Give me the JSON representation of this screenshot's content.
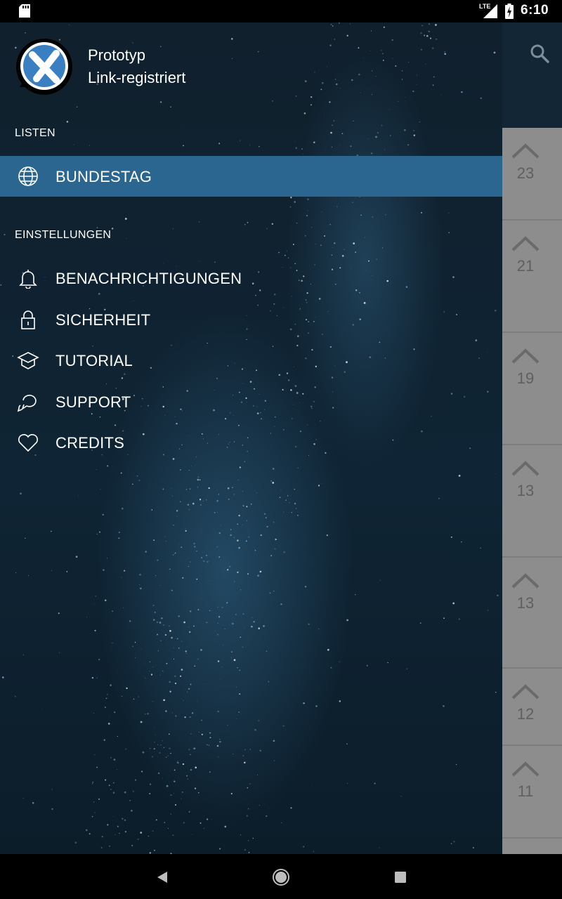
{
  "status_bar": {
    "time": "6:10",
    "network": "LTE",
    "icons": [
      "sd-card-icon",
      "signal-icon",
      "battery-charging-icon"
    ]
  },
  "app": {
    "icons": [
      "search-icon"
    ],
    "counts": [
      "23",
      "21",
      "19",
      "13",
      "13",
      "12",
      "11"
    ]
  },
  "drawer": {
    "title": "Prototyp",
    "subtitle": "Link-registriert",
    "sections": [
      {
        "label": "LISTEN",
        "items": [
          {
            "label": "BUNDESTAG",
            "icon": "globe-icon",
            "active": true
          }
        ]
      },
      {
        "label": "EINSTELLUNGEN",
        "items": [
          {
            "label": "BENACHRICHTIGUNGEN",
            "icon": "bell-icon"
          },
          {
            "label": "SICHERHEIT",
            "icon": "lock-icon"
          },
          {
            "label": "TUTORIAL",
            "icon": "graduation-cap-icon"
          },
          {
            "label": "SUPPORT",
            "icon": "chat-bubble-icon"
          },
          {
            "label": "CREDITS",
            "icon": "heart-icon"
          }
        ]
      }
    ]
  },
  "colors": {
    "accent": "#2b6690",
    "drawer_bg": "#10202d",
    "toolbar": "#122636"
  },
  "nav_bar": {
    "icons": [
      "back-icon",
      "home-icon",
      "recents-icon"
    ]
  }
}
